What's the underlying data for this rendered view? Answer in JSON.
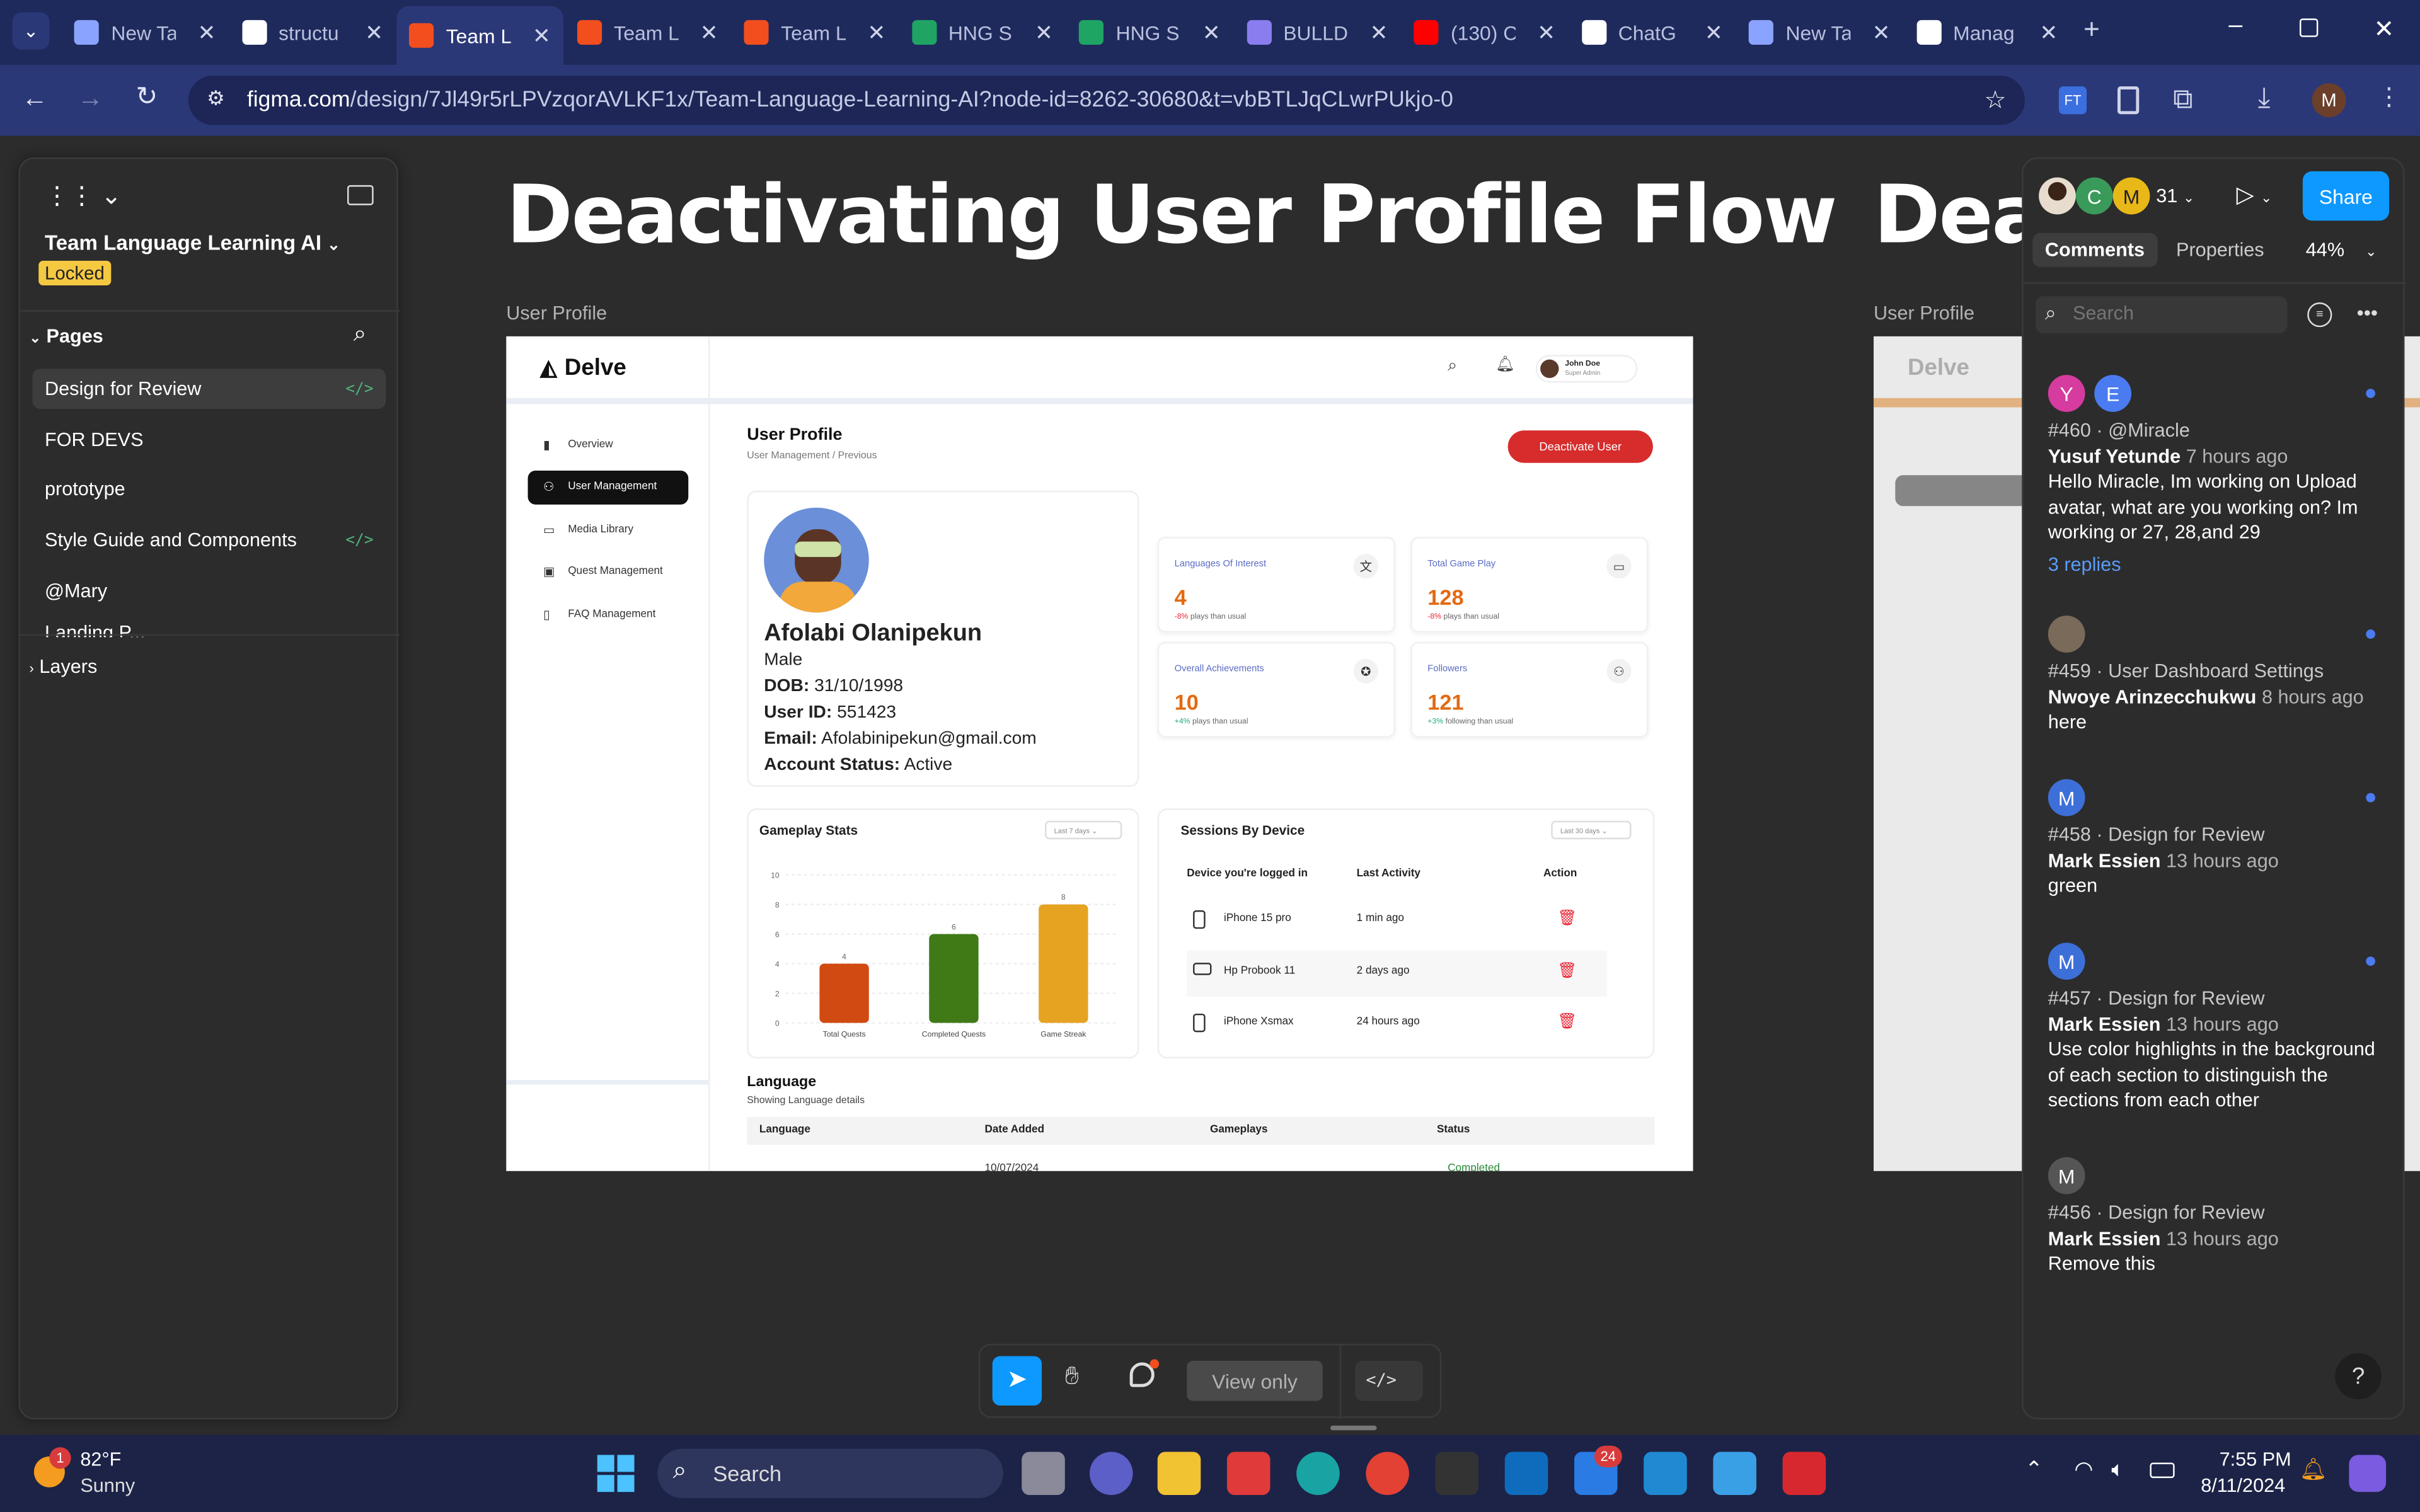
{
  "browser": {
    "tabs": [
      {
        "title": "New Ta",
        "icon": "chrome-icon",
        "color": "#8aa3ff"
      },
      {
        "title": "structu",
        "icon": "google-icon",
        "color": "#ffffff"
      },
      {
        "title": "Team L",
        "icon": "figma-icon",
        "color": "#f24e1e"
      },
      {
        "title": "Team L",
        "icon": "figma-icon",
        "color": "#f24e1e"
      },
      {
        "title": "Team L",
        "icon": "figma-icon",
        "color": "#f24e1e"
      },
      {
        "title": "HNG S",
        "icon": "sheets-icon",
        "color": "#1fa463"
      },
      {
        "title": "HNG S",
        "icon": "sheets-icon",
        "color": "#1fa463"
      },
      {
        "title": "BULLD",
        "icon": "link-icon",
        "color": "#8a7df0"
      },
      {
        "title": "(130) C",
        "icon": "youtube-icon",
        "color": "#ff0000"
      },
      {
        "title": "ChatG",
        "icon": "chatgpt-icon",
        "color": "#ffffff"
      },
      {
        "title": "New Ta",
        "icon": "chrome-icon",
        "color": "#8aa3ff"
      },
      {
        "title": "Manag",
        "icon": "github-icon",
        "color": "#ffffff"
      }
    ],
    "active_tab": 2,
    "url_domain": "figma.com",
    "url_path": "/design/7Jl49r5rLPVzqorAVLKF1x/Team-Language-Learning-AI?node-id=8262-30680&t=vbBTLJqCLwrPUkjo-0",
    "profile_initial": "M"
  },
  "figma": {
    "file_name": "Team Language Learning AI",
    "locked_label": "Locked",
    "pages_label": "Pages",
    "pages": [
      "Design for Review",
      "FOR DEVS",
      "prototype",
      "Style Guide and Components",
      "@Mary",
      "Landing P..."
    ],
    "layers_label": "Layers",
    "canvas_title": "Deactivating User Profile Flow",
    "canvas_title_2": "Deac",
    "frame_label": "User Profile",
    "frame_label_2": "User Profile",
    "toolbar": {
      "view_only": "View only",
      "code": "</>"
    },
    "header": {
      "user_count": "31",
      "share": "Share",
      "avatars": [
        "C",
        "M"
      ]
    },
    "panel_tabs": {
      "comments": "Comments",
      "properties": "Properties",
      "zoom": "44%"
    },
    "search_placeholder": "Search",
    "comments": [
      {
        "id": "#460",
        "page": "@Miracle",
        "author": "Yusuf Yetunde",
        "time": "7 hours ago",
        "text": "Hello Miracle, Im working on Upload avatar, what are you working on? Im working or 27, 28,and 29",
        "replies": "3 replies",
        "avatars": [
          "Y",
          "E"
        ]
      },
      {
        "id": "#459",
        "page": "User Dashboard Settings",
        "author": "Nwoye Arinzecchukwu",
        "time": "8 hours ago",
        "text": "here"
      },
      {
        "id": "#458",
        "page": "Design for Review",
        "author": "Mark Essien",
        "time": "13 hours ago",
        "text": "green",
        "avatar": "M"
      },
      {
        "id": "#457",
        "page": "Design for Review",
        "author": "Mark Essien",
        "time": "13 hours ago",
        "text": "Use color highlights in the background of each section to distinguish the sections from each other",
        "avatar": "M"
      },
      {
        "id": "#456",
        "page": "Design for Review",
        "author": "Mark Essien",
        "time": "13 hours ago",
        "text": "Remove this",
        "avatar": "M"
      }
    ],
    "help": "?"
  },
  "design": {
    "logo": "Delve",
    "user": {
      "name": "John Doe",
      "role": "Super Admin"
    },
    "nav": [
      "Overview",
      "User Management",
      "Media Library",
      "Quest Management",
      "FAQ Management"
    ],
    "page_title": "User Profile",
    "breadcrumb": [
      "User Management",
      "/",
      "Previous"
    ],
    "deactivate": "Deactivate User",
    "profile": {
      "name": "Afolabi Olanipekun",
      "gender": "Male",
      "dob_label": "DOB:",
      "dob": "31/10/1998",
      "uid_label": "User ID:",
      "uid": "551423",
      "email_label": "Email:",
      "email": "Afolabinipekun@gmail.com",
      "status_label": "Account Status:",
      "status": "Active"
    },
    "stats": [
      {
        "title": "Languages  Of Interest",
        "value": "4",
        "sub_pct": "-8%",
        "sub": "plays than usual",
        "icon": "translate-icon"
      },
      {
        "title": "Total Game Play",
        "value": "128",
        "sub_pct": "-8%",
        "sub": "plays than usual",
        "icon": "ticket-icon"
      },
      {
        "title": "Overall Achievements",
        "value": "10",
        "sub_pct": "+4%",
        "sub": "plays than usual",
        "icon": "award-icon"
      },
      {
        "title": "Followers",
        "value": "121",
        "sub_pct": "+3%",
        "sub": "following than usual",
        "icon": "users-icon"
      }
    ],
    "gameplay": {
      "title": "Gameplay Stats",
      "range": "Last 7 days"
    },
    "sessions": {
      "title": "Sessions By Device",
      "range": "Last 30 days",
      "headers": [
        "Device you're logged in",
        "Last Activity",
        "Action"
      ],
      "rows": [
        {
          "device": "iPhone 15 pro",
          "last": "1 min ago"
        },
        {
          "device": "Hp Probook 11",
          "last": "2 days ago"
        },
        {
          "device": "iPhone Xsmax",
          "last": "24 hours ago"
        }
      ]
    },
    "language": {
      "title": "Language",
      "subtitle": "Showing Language details",
      "headers": [
        "Language",
        "Date Added",
        "Gameplays",
        "Status"
      ],
      "row": [
        "",
        "10/07/2024",
        "",
        "Completed"
      ]
    }
  },
  "chart_data": {
    "type": "bar",
    "categories": [
      "Total Quests",
      "Completed Quests",
      "Game Streak"
    ],
    "values": [
      4,
      6,
      8
    ],
    "colors": [
      "#d14a12",
      "#3f7a17",
      "#e6a322"
    ],
    "ylim": [
      0,
      10
    ],
    "yticks": [
      0,
      2,
      4,
      6,
      8,
      10
    ]
  },
  "taskbar": {
    "weather_temp": "82°F",
    "weather_desc": "Sunny",
    "weather_badge": "1",
    "search": "Search",
    "time": "7:55 PM",
    "date": "8/11/2024",
    "badge": "24"
  }
}
